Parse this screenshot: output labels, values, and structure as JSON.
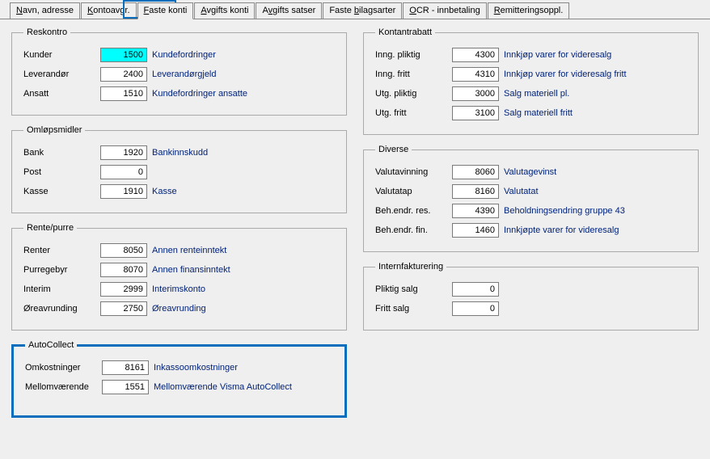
{
  "tabs": [
    {
      "pre": "",
      "u": "N",
      "post": "avn, adresse"
    },
    {
      "pre": "",
      "u": "K",
      "post": "ontoavgr."
    },
    {
      "pre": "",
      "u": "F",
      "post": "aste konti"
    },
    {
      "pre": "",
      "u": "A",
      "post": "vgifts konti"
    },
    {
      "pre": "A",
      "u": "v",
      "post": "gifts satser"
    },
    {
      "pre": "Faste ",
      "u": "b",
      "post": "ilagsarter"
    },
    {
      "pre": "",
      "u": "O",
      "post": "CR - innbetaling"
    },
    {
      "pre": "",
      "u": "R",
      "post": "emitteringsoppl."
    }
  ],
  "groups": {
    "reskontro": {
      "title": "Reskontro",
      "rows": [
        {
          "label": "Kunder",
          "value": "1500",
          "desc": "Kundefordringer",
          "selected": true
        },
        {
          "label": "Leverandør",
          "value": "2400",
          "desc": "Leverandørgjeld"
        },
        {
          "label": "Ansatt",
          "value": "1510",
          "desc": "Kundefordringer ansatte"
        }
      ]
    },
    "omlop": {
      "title": "Omløpsmidler",
      "rows": [
        {
          "label": "Bank",
          "value": "1920",
          "desc": "Bankinnskudd"
        },
        {
          "label": "Post",
          "value": "0",
          "desc": ""
        },
        {
          "label": "Kasse",
          "value": "1910",
          "desc": "Kasse"
        }
      ]
    },
    "rente": {
      "title": "Rente/purre",
      "rows": [
        {
          "label": "Renter",
          "value": "8050",
          "desc": "Annen renteinntekt"
        },
        {
          "label": "Purregebyr",
          "value": "8070",
          "desc": "Annen finansinntekt"
        },
        {
          "label": "Interim",
          "value": "2999",
          "desc": "Interimskonto"
        },
        {
          "label": "Øreavrunding",
          "value": "2750",
          "desc": "Øreavrunding"
        }
      ]
    },
    "autocollect": {
      "title": "AutoCollect",
      "rows": [
        {
          "label": "Omkostninger",
          "value": "8161",
          "desc": "Inkassoomkostninger"
        },
        {
          "label": "Mellomværende",
          "value": "1551",
          "desc": "Mellomværende Visma AutoCollect"
        }
      ]
    },
    "kontant": {
      "title": "Kontantrabatt",
      "rows": [
        {
          "label": "Inng. pliktig",
          "value": "4300",
          "desc": "Innkjøp varer for videresalg"
        },
        {
          "label": "Inng. fritt",
          "value": "4310",
          "desc": "Innkjøp varer for videresalg fritt"
        },
        {
          "label": "Utg. pliktig",
          "value": "3000",
          "desc": "Salg materiell pl."
        },
        {
          "label": "Utg. fritt",
          "value": "3100",
          "desc": "Salg materiell fritt"
        }
      ]
    },
    "diverse": {
      "title": "Diverse",
      "rows": [
        {
          "label": "Valutavinning",
          "value": "8060",
          "desc": "Valutagevinst"
        },
        {
          "label": "Valutatap",
          "value": "8160",
          "desc": "Valutatat"
        },
        {
          "label": "Beh.endr. res.",
          "value": "4390",
          "desc": "Beholdningsendring gruppe 43"
        },
        {
          "label": "Beh.endr. fin.",
          "value": "1460",
          "desc": "Innkjøpte varer for videresalg"
        }
      ]
    },
    "intern": {
      "title": "Internfakturering",
      "rows": [
        {
          "label": "Pliktig salg",
          "value": "0",
          "desc": ""
        },
        {
          "label": "Fritt salg",
          "value": "0",
          "desc": ""
        }
      ]
    }
  }
}
